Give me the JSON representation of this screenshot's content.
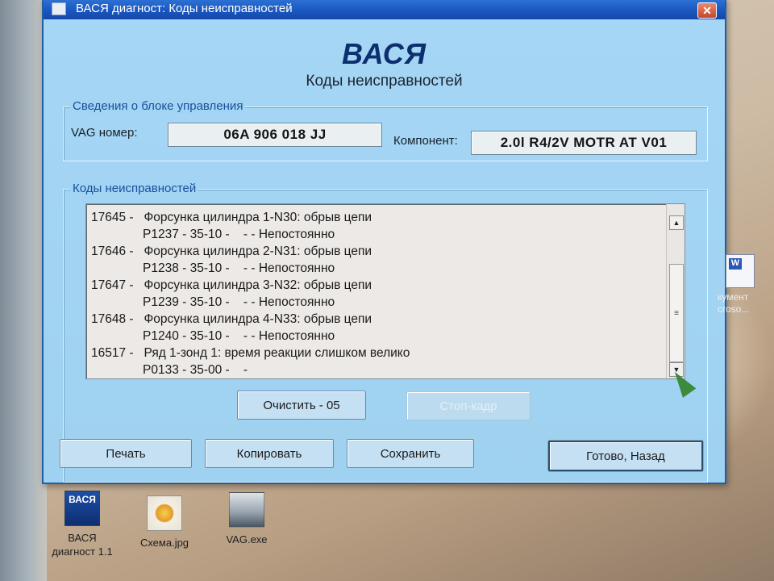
{
  "window": {
    "title": "ВАСЯ диагност: Коды неисправностей",
    "close_glyph": "✕"
  },
  "header": {
    "brand": "ВАСЯ",
    "subtitle": "Коды неисправностей"
  },
  "ecu_info": {
    "legend": "Сведения о блоке управления",
    "vag_label": "VAG номер:",
    "vag_value": "06A 906 018 JJ",
    "component_label": "Компонент:",
    "component_value": "2.0l R4/2V  MOTR AT V01"
  },
  "fault_codes": {
    "legend": "Коды неисправностей",
    "rows": [
      {
        "line1": "17645 -   Форсунка цилиндра 1-N30: обрыв цепи",
        "line2": "P1237 - 35-10 -    - - Непостоянно"
      },
      {
        "line1": "17646 -   Форсунка цилиндра 2-N31: обрыв цепи",
        "line2": "P1238 - 35-10 -    - - Непостоянно"
      },
      {
        "line1": "17647 -   Форсунка цилиндра 3-N32: обрыв цепи",
        "line2": "P1239 - 35-10 -    - - Непостоянно"
      },
      {
        "line1": "17648 -   Форсунка цилиндра 4-N33: обрыв цепи",
        "line2": "P1240 - 35-10 -    - - Непостоянно"
      },
      {
        "line1": "16517 -   Ряд 1-зонд 1: время реакции слишком велико",
        "line2": "P0133 - 35-00 -    -"
      }
    ]
  },
  "scrollbar": {
    "up_glyph": "▲",
    "down_glyph": "▼",
    "thumb_glyph": "≡"
  },
  "buttons": {
    "clear": "Очистить - 05",
    "freeze_frame": "Стоп-кадр",
    "print": "Печать",
    "copy": "Копировать",
    "save": "Сохранить",
    "done_back": "Готово, Назад"
  },
  "desktop": {
    "icons": [
      {
        "caption": "ВАСЯ\nдиагност 1.1",
        "icon": "vasya-app-icon"
      },
      {
        "caption": "Схема.jpg",
        "icon": "image-file-icon"
      },
      {
        "caption": "VAG.exe",
        "icon": "car-exe-icon"
      }
    ],
    "partial_icon": {
      "caption_line1": "кумент",
      "caption_line2": "croso...",
      "glyph": "W"
    },
    "vasya_icon_text": "ВАСЯ"
  },
  "colors": {
    "titlebar": "#1a56c0",
    "client_bg": "#a2d4f3",
    "brand": "#0d2f6e",
    "legend": "#1a4f9c"
  }
}
